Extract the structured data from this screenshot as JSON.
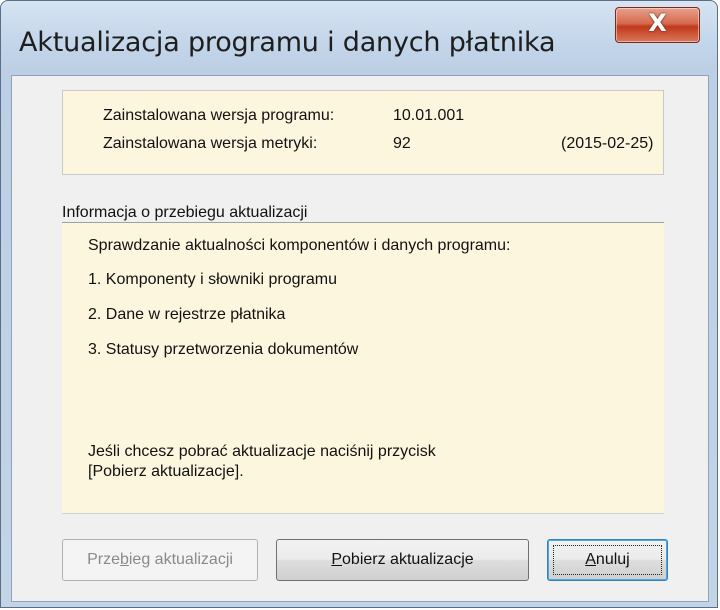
{
  "window": {
    "title": "Aktualizacja programu i danych płatnika",
    "close_label": "X"
  },
  "versions": {
    "program_label": "Zainstalowana wersja programu:",
    "program_value": "10.01.001",
    "metryka_label": "Zainstalowana wersja metryki:",
    "metryka_value": "92",
    "metryka_date": "(2015-02-25)"
  },
  "info": {
    "section_label": "Informacja o przebiegu aktualizacji",
    "lines": [
      "Sprawdzanie aktualności komponentów i danych programu:",
      "1. Komponenty i słowniki programu",
      "2. Dane w rejestrze płatnika",
      "3. Statusy przetworzenia dokumentów"
    ],
    "hint_line1": "Jeśli chcesz pobrać aktualizacje naciśnij przycisk",
    "hint_line2": "[Pobierz aktualizacje]."
  },
  "buttons": {
    "przebieg": {
      "pre": "Prze",
      "u": "b",
      "post": "ieg aktualizacji",
      "enabled": false
    },
    "pobierz": {
      "pre": "",
      "u": "P",
      "post": "obierz aktualizacje",
      "enabled": true
    },
    "anuluj": {
      "pre": "",
      "u": "A",
      "post": "nuluj",
      "enabled": true,
      "default": true
    }
  }
}
